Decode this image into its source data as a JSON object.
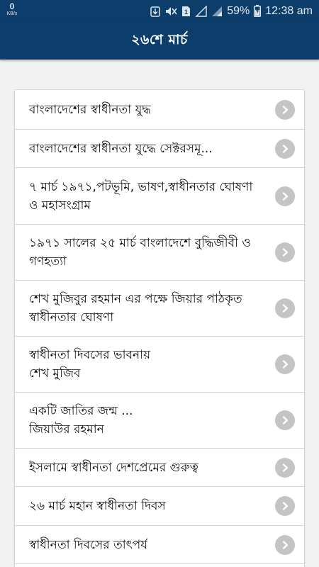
{
  "status_bar": {
    "net_speed": "0",
    "net_unit": "KB/s",
    "battery_percent": "59%",
    "time": "12:38 am",
    "icons": [
      "download-icon",
      "mute-icon",
      "sim-card-icon",
      "no-signal-icon",
      "signal-icon",
      "battery-icon"
    ]
  },
  "app_bar": {
    "title": "২৬শে মার্চ"
  },
  "colors": {
    "primary": "#0d3d6b",
    "chevron_bg": "#c4c4c4",
    "background": "#f2f2f2"
  },
  "list": {
    "items": [
      {
        "label": "বাংলাদেশের স্বাধীনতা যুদ্ধ",
        "icon": "chevron-right-icon"
      },
      {
        "label": "বাংলাদেশের স্বাধীনতা যুদ্ধে সেক্টরসমূ...",
        "icon": "chevron-right-icon"
      },
      {
        "label": "৭ মার্চ ১৯৭১,পটভূমি, ভাষণ,স্বাধীনতার ঘোষণা ও মহাসংগ্রাম",
        "icon": "chevron-right-icon"
      },
      {
        "label": "১৯৭১ সালের ২৫ মার্চ বাংলাদেশে বুদ্ধিজীবী ও গণহত্যা",
        "icon": "chevron-right-icon"
      },
      {
        "label": "শেখ মুজিবুর রহমান এর পক্ষে জিয়ার পাঠকৃত স্বাধীনতার ঘোষণা",
        "icon": "chevron-right-icon"
      },
      {
        "label": "স্বাধীনতা দিবসের ভাবনায় শেখ মুজিব",
        "icon": "chevron-right-icon"
      },
      {
        "label": "একটি জাতির জন্ম ... জিয়াউর রহমান",
        "icon": "chevron-right-icon"
      },
      {
        "label": "ইসলামে স্বাধীনতা দেশপ্রেমের গুরুত্ব",
        "icon": "chevron-right-icon"
      },
      {
        "label": "২৬ মার্চ মহান স্বাধীনতা দিবস",
        "icon": "chevron-right-icon"
      },
      {
        "label": "স্বাধীনতা দিবসের তাৎপর্য",
        "icon": "chevron-right-icon"
      }
    ]
  }
}
